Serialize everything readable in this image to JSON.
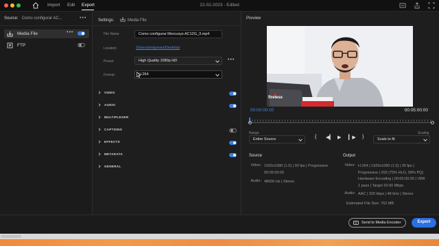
{
  "window": {
    "tabs": [
      {
        "label": "Import"
      },
      {
        "label": "Edit"
      },
      {
        "label": "Export"
      }
    ],
    "document_title": "22-02-2023 - Edited",
    "traffic_colors": [
      "#fe5f57",
      "#febc2e",
      "#28c840"
    ]
  },
  "source": {
    "label": "Source:",
    "file": "Como configurar AC...",
    "destinations": [
      {
        "label": "Media File",
        "icon": "media-file-icon",
        "selected": true,
        "enabled": true
      },
      {
        "label": "FTP",
        "icon": "ftp-icon",
        "selected": false,
        "enabled": false
      }
    ]
  },
  "settings": {
    "label": "Settings:",
    "destination": "Media File",
    "file_name_label": "File Name",
    "file_name_value": "Como configurar Mercusys AC12G_3.mp4",
    "location_label": "Location",
    "location_value": "/Users/amquesia/Desktop/",
    "preset_label": "Preset",
    "preset_value": "High Quality 1080p HD",
    "format_label": "Format",
    "format_value": "H.264",
    "sections": [
      {
        "label": "VIDEO",
        "toggle": true
      },
      {
        "label": "AUDIO",
        "toggle": true
      },
      {
        "label": "MULTIPLEXER",
        "toggle": null
      },
      {
        "label": "CAPTIONS",
        "toggle": false
      },
      {
        "label": "EFFECTS",
        "toggle": true
      },
      {
        "label": "METADATA",
        "toggle": true
      },
      {
        "label": "GENERAL",
        "toggle": null
      }
    ]
  },
  "preview": {
    "label": "Preview",
    "video_overlay_text": "fireless",
    "current_time": "00:00:00:00",
    "end_time": "00:05:00:00",
    "range_label": "Range",
    "range_value": "Entire Source",
    "scaling_label": "Scaling",
    "scaling_value": "Scale to fit",
    "source_info": {
      "heading": "Source",
      "video_key": "Video:",
      "video_lines": [
        "1920x1080 (1.0)  |  30 fps  |  Progressive",
        "00:05:00:00"
      ],
      "audio_key": "Audio:",
      "audio_lines": [
        "48000 Hz  |  Stereo"
      ]
    },
    "output_info": {
      "heading": "Output",
      "video_key": "Video:",
      "video_lines": [
        "H.264  |  1920x1080 (1.0)  |  30 fps  |",
        "Progressive  |  203 (75% HLG, 58% PQ)",
        "Hardware Encoding  |  00:05:00:00  |  VBR",
        "1 pass  |  Target 20.00 Mbps"
      ],
      "audio_key": "Audio:",
      "audio_lines": [
        "AAC  |  320 kbps  |  48 kHz  |  Stereo"
      ],
      "size_label": "Estimated File Size:",
      "size_value": "762 MB"
    }
  },
  "footer": {
    "ame_label": "Send to Media Encoder",
    "export_label": "Export"
  },
  "colors": {
    "accent": "#2c6fe0",
    "link": "#4a86d8",
    "dock": "#f08a3c"
  }
}
